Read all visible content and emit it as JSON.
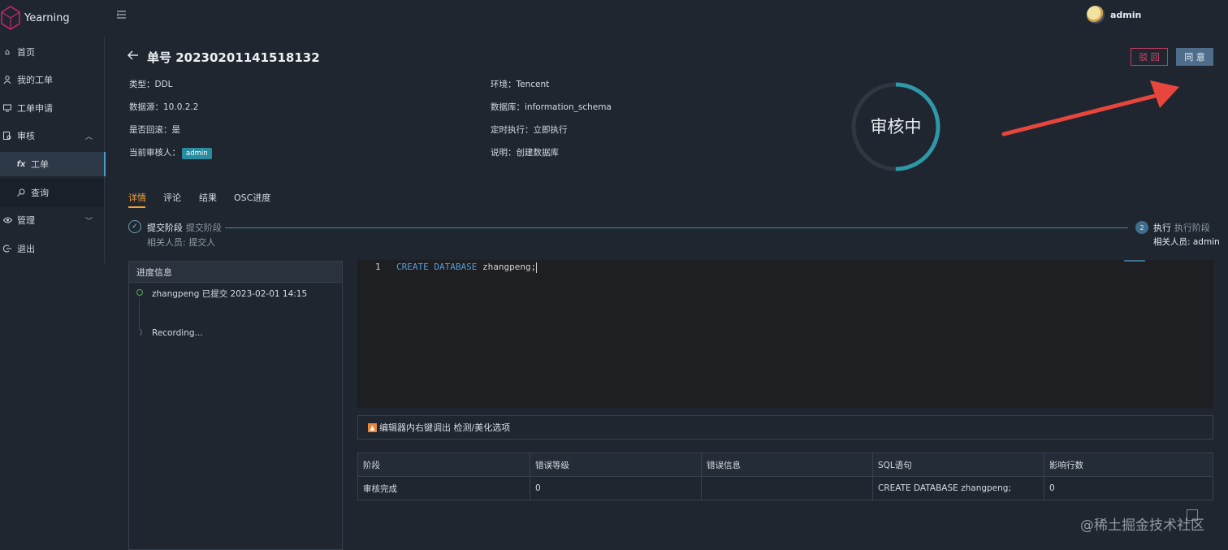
{
  "app": {
    "brand": "Yearning"
  },
  "header": {
    "username": "admin"
  },
  "sidebar": {
    "items": [
      {
        "label": "首页"
      },
      {
        "label": "我的工单"
      },
      {
        "label": "工单申请"
      },
      {
        "label": "审核"
      },
      {
        "label": "工单",
        "prefix": "fx"
      },
      {
        "label": "查询"
      },
      {
        "label": "管理"
      },
      {
        "label": "退出"
      }
    ]
  },
  "order": {
    "title": "单号 20230201141518132",
    "reject_label": "驳 回",
    "approve_label": "同 意",
    "left_info": [
      {
        "text": "类型：DDL"
      },
      {
        "text": "数据源：10.0.2.2"
      },
      {
        "text": "是否回滚：是"
      },
      {
        "text": "当前审核人：",
        "badge": "admin"
      }
    ],
    "right_info": [
      {
        "text": "环境：Tencent"
      },
      {
        "text": "数据库：information_schema"
      },
      {
        "text": "定时执行：立即执行"
      },
      {
        "text": "说明：创建数据库"
      }
    ],
    "status": "审核中",
    "status_progress": 0.5
  },
  "tabs": [
    "详情",
    "评论",
    "结果",
    "OSC进度"
  ],
  "steps": [
    {
      "title": "提交阶段",
      "subtitle": "提交阶段",
      "desc": "相关人员: 提交人"
    },
    {
      "num": "2",
      "title": "执行",
      "subtitle": "执行阶段",
      "desc": "相关人员: admin"
    }
  ],
  "progress": {
    "header": "进度信息",
    "entries": [
      {
        "text": "zhangpeng 已提交 2023-02-01 14:15"
      },
      {
        "text": "Recording..."
      }
    ]
  },
  "editor": {
    "line_no": "1",
    "keyword1": "CREATE",
    "keyword2": "DATABASE",
    "identifier": "zhangpeng;"
  },
  "hint": {
    "text": "编辑器内右键调出 检测/美化选项"
  },
  "table": {
    "headers": [
      "阶段",
      "错误等级",
      "错误信息",
      "SQL语句",
      "影响行数"
    ],
    "rows": [
      [
        "审核完成",
        "0",
        "",
        "CREATE DATABASE zhangpeng;",
        "0"
      ]
    ]
  },
  "watermark": "@稀土掘金技术社区",
  "colors": {
    "background": "#1f2630",
    "accent": "#2a8ca0",
    "tab_active": "#f5a133",
    "reject": "#c23b5f",
    "approve": "#4d6d8a",
    "arrow": "#e8453c"
  }
}
